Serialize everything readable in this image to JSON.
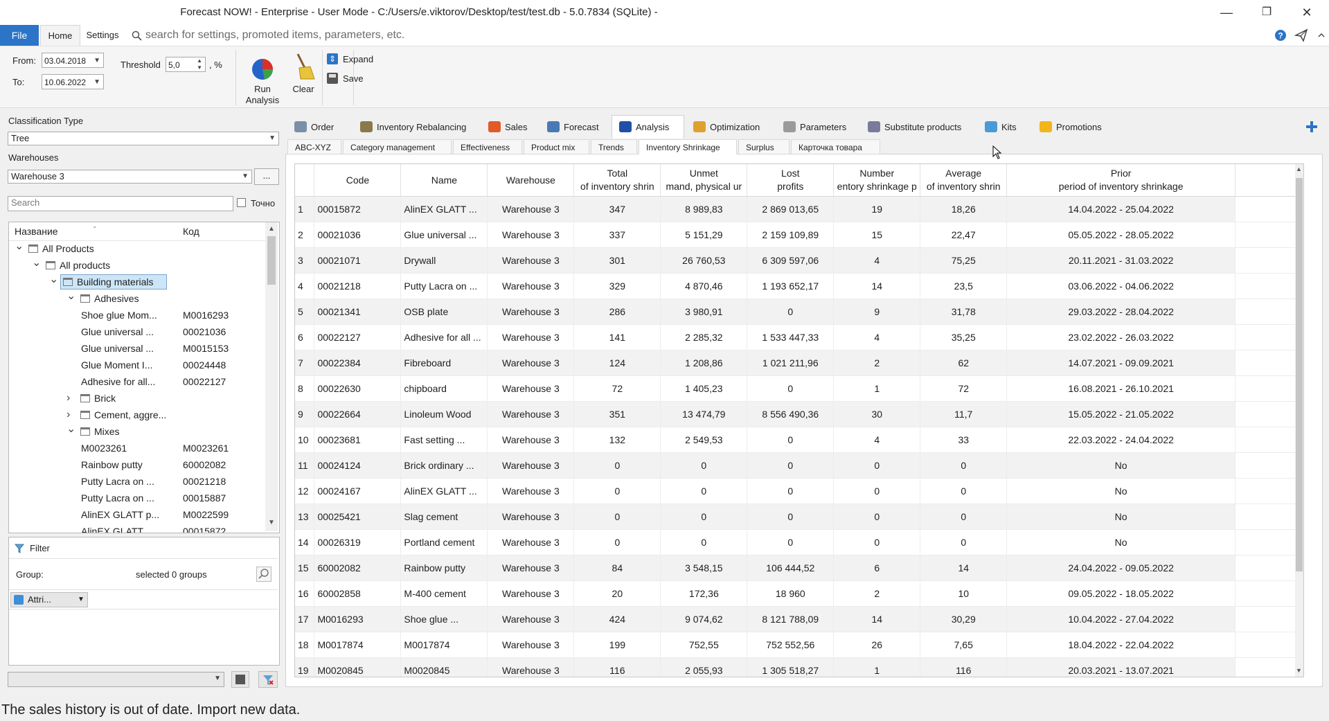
{
  "window": {
    "title": "Forecast NOW! - Enterprise - User Mode - C:/Users/e.viktorov/Desktop/test/test.db - 5.0.7834 (SQLite) -",
    "minimize": "—",
    "maximize": "❐",
    "close": "✕"
  },
  "menu": {
    "file": "File",
    "home": "Home",
    "settings": "Settings",
    "search_placeholder": "search for settings, promoted items, parameters, etc."
  },
  "ribbon": {
    "from_label": "From:",
    "from_value": "03.04.2018",
    "to_label": "To:",
    "to_value": "10.06.2022",
    "threshold_label": "Threshold",
    "threshold_value": "5,0",
    "threshold_unit": ", %",
    "run_analysis_line1": "Run",
    "run_analysis_line2": "Analysis",
    "clear": "Clear",
    "expand": "Expand",
    "save": "Save"
  },
  "left": {
    "classification_label": "Classification Type",
    "classification_value": "Tree",
    "warehouses_label": "Warehouses",
    "warehouse_value": "Warehouse 3",
    "more_button": "...",
    "search_placeholder": "Search",
    "exact_label": "Точно",
    "tree_col_name": "Название",
    "tree_col_code": "Код",
    "tree_items": [
      {
        "name": "All Products",
        "code": "",
        "level": 0,
        "expander": "v",
        "cart": true
      },
      {
        "name": "All products",
        "code": "",
        "level": 1,
        "expander": "v",
        "cart": true
      },
      {
        "name": "Building materials",
        "code": "",
        "level": 2,
        "expander": "v",
        "cart": true,
        "selected": true
      },
      {
        "name": "Adhesives",
        "code": "",
        "level": 3,
        "expander": "v",
        "cart": true
      },
      {
        "name": "Shoe glue Mom...",
        "code": "M0016293",
        "level": 4,
        "expander": "",
        "cart": false
      },
      {
        "name": "Glue universal ...",
        "code": "00021036",
        "level": 4,
        "expander": "",
        "cart": false
      },
      {
        "name": "Glue universal ...",
        "code": "M0015153",
        "level": 4,
        "expander": "",
        "cart": false
      },
      {
        "name": "Glue Moment I...",
        "code": "00024448",
        "level": 4,
        "expander": "",
        "cart": false
      },
      {
        "name": "Adhesive for all...",
        "code": "00022127",
        "level": 4,
        "expander": "",
        "cart": false
      },
      {
        "name": "Brick",
        "code": "",
        "level": 3,
        "expander": ">",
        "cart": true
      },
      {
        "name": "Cement, aggre...",
        "code": "",
        "level": 3,
        "expander": ">",
        "cart": true
      },
      {
        "name": "Mixes",
        "code": "",
        "level": 3,
        "expander": "v",
        "cart": true
      },
      {
        "name": "M0023261",
        "code": "M0023261",
        "level": 4,
        "expander": "",
        "cart": false
      },
      {
        "name": "Rainbow putty",
        "code": "60002082",
        "level": 4,
        "expander": "",
        "cart": false
      },
      {
        "name": "Putty Lacra on ...",
        "code": "00021218",
        "level": 4,
        "expander": "",
        "cart": false
      },
      {
        "name": "Putty Lacra on ...",
        "code": "00015887",
        "level": 4,
        "expander": "",
        "cart": false
      },
      {
        "name": "AlinEX GLATT p...",
        "code": "M0022599",
        "level": 4,
        "expander": "",
        "cart": false
      },
      {
        "name": "AlinEX GLATT ...",
        "code": "00015872",
        "level": 4,
        "expander": "",
        "cart": false
      }
    ],
    "filter_title": "Filter",
    "group_label": "Group:",
    "group_value": "selected 0 groups",
    "attr_button": "Attri..."
  },
  "tabs": [
    {
      "label": "Order",
      "color": "#7a8fa8"
    },
    {
      "label": "Inventory Rebalancing",
      "color": "#8a7a4a"
    },
    {
      "label": "Sales",
      "color": "#e05a2a"
    },
    {
      "label": "Forecast",
      "color": "#4a7ab5"
    },
    {
      "label": "Analysis",
      "color": "#1f4fa8",
      "active": true
    },
    {
      "label": "Optimization",
      "color": "#e0a030"
    },
    {
      "label": "Parameters",
      "color": "#9a9a9a"
    },
    {
      "label": "Substitute products",
      "color": "#7a7a9a"
    },
    {
      "label": "Kits",
      "color": "#4a9ad8"
    },
    {
      "label": "Promotions",
      "color": "#f2b51a"
    }
  ],
  "subtabs": [
    {
      "label": "ABC-XYZ"
    },
    {
      "label": "Category management"
    },
    {
      "label": "Effectiveness"
    },
    {
      "label": "Product mix"
    },
    {
      "label": "Trends"
    },
    {
      "label": "Inventory Shrinkage",
      "active": true
    },
    {
      "label": "Surplus"
    },
    {
      "label": "Карточка товара"
    }
  ],
  "grid": {
    "columns": [
      {
        "l1": "",
        "l2": "Code"
      },
      {
        "l1": "",
        "l2": "Name"
      },
      {
        "l1": "",
        "l2": "Warehouse"
      },
      {
        "l1": "Total",
        "l2": "of inventory shrin"
      },
      {
        "l1": "Unmet",
        "l2": "mand, physical ur"
      },
      {
        "l1": "Lost",
        "l2": "profits"
      },
      {
        "l1": "Number",
        "l2": "entory shrinkage p"
      },
      {
        "l1": "Average",
        "l2": "of inventory shrin"
      },
      {
        "l1": "Prior",
        "l2": "period of inventory shrinkage"
      }
    ],
    "rows": [
      [
        "1",
        "00015872",
        "AlinEX GLATT ...",
        "Warehouse 3",
        "347",
        "8 989,83",
        "2 869 013,65",
        "19",
        "18,26",
        "14.04.2022 - 25.04.2022"
      ],
      [
        "2",
        "00021036",
        "Glue universal ...",
        "Warehouse 3",
        "337",
        "5 151,29",
        "2 159 109,89",
        "15",
        "22,47",
        "05.05.2022 - 28.05.2022"
      ],
      [
        "3",
        "00021071",
        "Drywall",
        "Warehouse 3",
        "301",
        "26 760,53",
        "6 309 597,06",
        "4",
        "75,25",
        "20.11.2021 - 31.03.2022"
      ],
      [
        "4",
        "00021218",
        "Putty Lacra on ...",
        "Warehouse 3",
        "329",
        "4 870,46",
        "1 193 652,17",
        "14",
        "23,5",
        "03.06.2022 - 04.06.2022"
      ],
      [
        "5",
        "00021341",
        "OSB plate",
        "Warehouse 3",
        "286",
        "3 980,91",
        "0",
        "9",
        "31,78",
        "29.03.2022 - 28.04.2022"
      ],
      [
        "6",
        "00022127",
        "Adhesive for all ...",
        "Warehouse 3",
        "141",
        "2 285,32",
        "1 533 447,33",
        "4",
        "35,25",
        "23.02.2022 - 26.03.2022"
      ],
      [
        "7",
        "00022384",
        "Fibreboard",
        "Warehouse 3",
        "124",
        "1 208,86",
        "1 021 211,96",
        "2",
        "62",
        "14.07.2021 - 09.09.2021"
      ],
      [
        "8",
        "00022630",
        "chipboard",
        "Warehouse 3",
        "72",
        "1 405,23",
        "0",
        "1",
        "72",
        "16.08.2021 - 26.10.2021"
      ],
      [
        "9",
        "00022664",
        "Linoleum Wood",
        "Warehouse 3",
        "351",
        "13 474,79",
        "8 556 490,36",
        "30",
        "11,7",
        "15.05.2022 - 21.05.2022"
      ],
      [
        "10",
        "00023681",
        "Fast setting ...",
        "Warehouse 3",
        "132",
        "2 549,53",
        "0",
        "4",
        "33",
        "22.03.2022 - 24.04.2022"
      ],
      [
        "11",
        "00024124",
        "Brick ordinary ...",
        "Warehouse 3",
        "0",
        "0",
        "0",
        "0",
        "0",
        "No"
      ],
      [
        "12",
        "00024167",
        "AlinEX GLATT ...",
        "Warehouse 3",
        "0",
        "0",
        "0",
        "0",
        "0",
        "No"
      ],
      [
        "13",
        "00025421",
        "Slag cement",
        "Warehouse 3",
        "0",
        "0",
        "0",
        "0",
        "0",
        "No"
      ],
      [
        "14",
        "00026319",
        "Portland cement",
        "Warehouse 3",
        "0",
        "0",
        "0",
        "0",
        "0",
        "No"
      ],
      [
        "15",
        "60002082",
        "Rainbow putty",
        "Warehouse 3",
        "84",
        "3 548,15",
        "106 444,52",
        "6",
        "14",
        "24.04.2022 - 09.05.2022"
      ],
      [
        "16",
        "60002858",
        "M-400 cement",
        "Warehouse 3",
        "20",
        "172,36",
        "18 960",
        "2",
        "10",
        "09.05.2022 - 18.05.2022"
      ],
      [
        "17",
        "M0016293",
        "Shoe glue ...",
        "Warehouse 3",
        "424",
        "9 074,62",
        "8 121 788,09",
        "14",
        "30,29",
        "10.04.2022 - 27.04.2022"
      ],
      [
        "18",
        "M0017874",
        "M0017874",
        "Warehouse 3",
        "199",
        "752,55",
        "752 552,56",
        "26",
        "7,65",
        "18.04.2022 - 22.04.2022"
      ],
      [
        "19",
        "M0020845",
        "M0020845",
        "Warehouse 3",
        "116",
        "2 055,93",
        "1 305 518,27",
        "1",
        "116",
        "20.03.2021 - 13.07.2021"
      ]
    ]
  },
  "status": "The sales history is out of date. Import new data."
}
